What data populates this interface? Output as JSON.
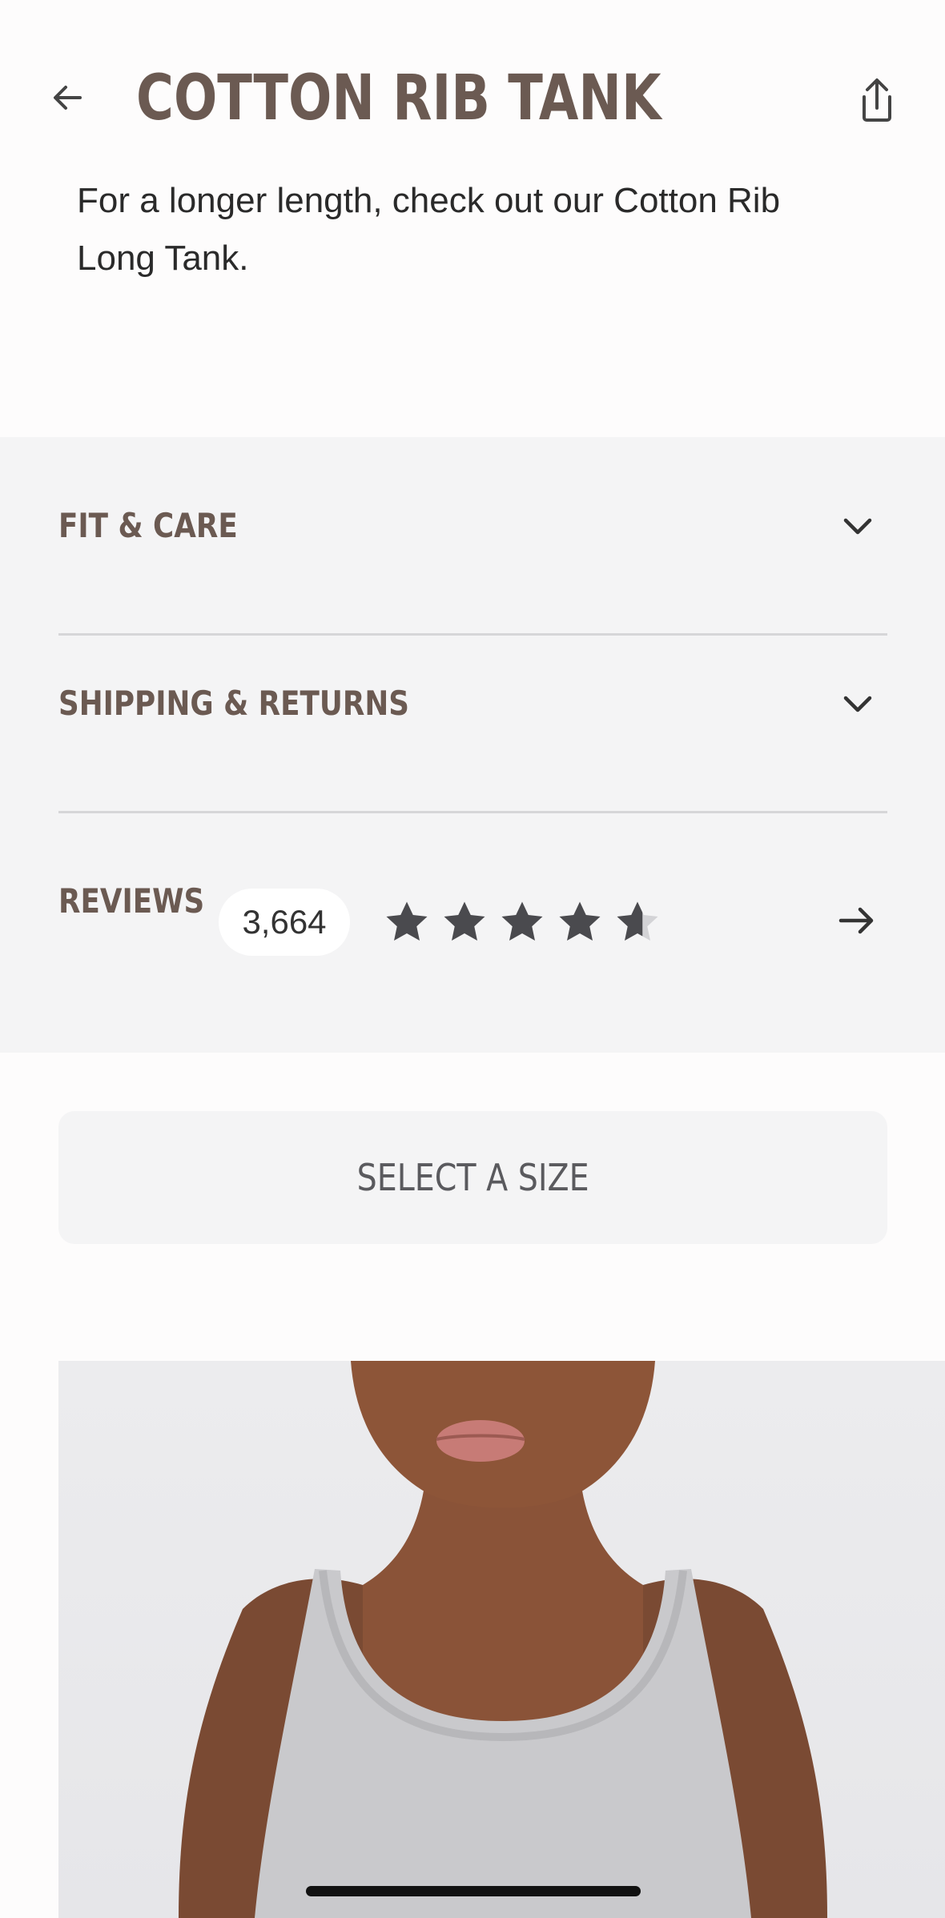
{
  "header": {
    "title": "COTTON RIB TANK",
    "back_icon": "arrow-left-icon",
    "share_icon": "share-icon"
  },
  "description": {
    "text": "For a longer length, check out our Cotton Rib Long Tank."
  },
  "accordion": {
    "items": [
      {
        "label": "FIT & CARE",
        "icon": "chevron-down-icon"
      },
      {
        "label": "SHIPPING & RETURNS",
        "icon": "chevron-down-icon"
      }
    ]
  },
  "reviews": {
    "label": "REVIEWS",
    "count": "3,664",
    "rating": 4.6,
    "max_rating": 5,
    "arrow_icon": "arrow-right-icon"
  },
  "size_selector": {
    "label": "SELECT A SIZE"
  },
  "product_image": {
    "alt_icon": "product-photo"
  },
  "colors": {
    "brand_text": "#6b5a52",
    "panel_bg": "#f4f4f5",
    "star": "#4a4a4e"
  }
}
